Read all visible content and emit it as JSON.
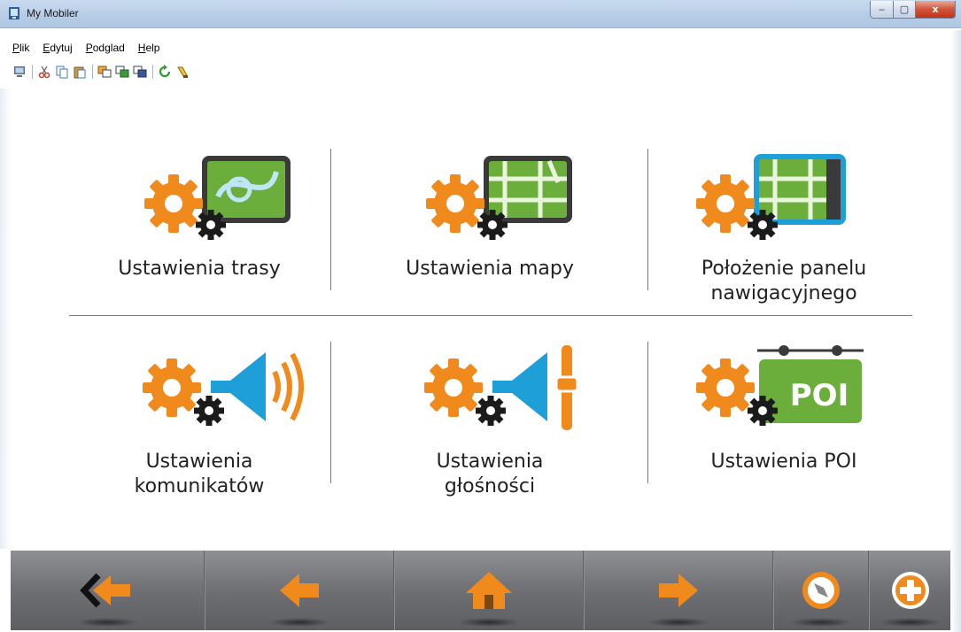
{
  "window": {
    "title": "My Mobiler",
    "min_glyph": "‒",
    "max_glyph": "▢",
    "close_glyph": "x"
  },
  "menu": {
    "items": [
      "Plik",
      "Edytuj",
      "Podglad",
      "Help"
    ]
  },
  "toolbar": {
    "icons": [
      "monitor-icon",
      "cut-icon",
      "copy-icon",
      "paste-icon",
      "window-icon",
      "window-2-icon",
      "window-3-icon",
      "refresh-icon",
      "brush-icon"
    ]
  },
  "settings": {
    "tiles": [
      {
        "label": "Ustawienia trasy",
        "icon": "route-settings-icon"
      },
      {
        "label": "Ustawienia mapy",
        "icon": "map-settings-icon"
      },
      {
        "label": "Położenie panelu\nnawigacyjnego",
        "icon": "nav-panel-position-icon"
      },
      {
        "label": "Ustawienia\nkomunikatów",
        "icon": "announcements-settings-icon"
      },
      {
        "label": "Ustawienia\ngłośności",
        "icon": "volume-settings-icon"
      },
      {
        "label": "Ustawienia POI",
        "icon": "poi-settings-icon"
      }
    ],
    "poi_badge": "POI"
  },
  "navbar": {
    "buttons": [
      "back-exit-icon",
      "back-arrow-icon",
      "home-icon",
      "forward-arrow-icon",
      "compass-icon",
      "add-icon"
    ]
  },
  "colors": {
    "gear_orange": "#f08a1c",
    "map_green": "#6cae3c",
    "speaker_blue": "#1f9fd8",
    "nav_bar": "#6f7074"
  }
}
